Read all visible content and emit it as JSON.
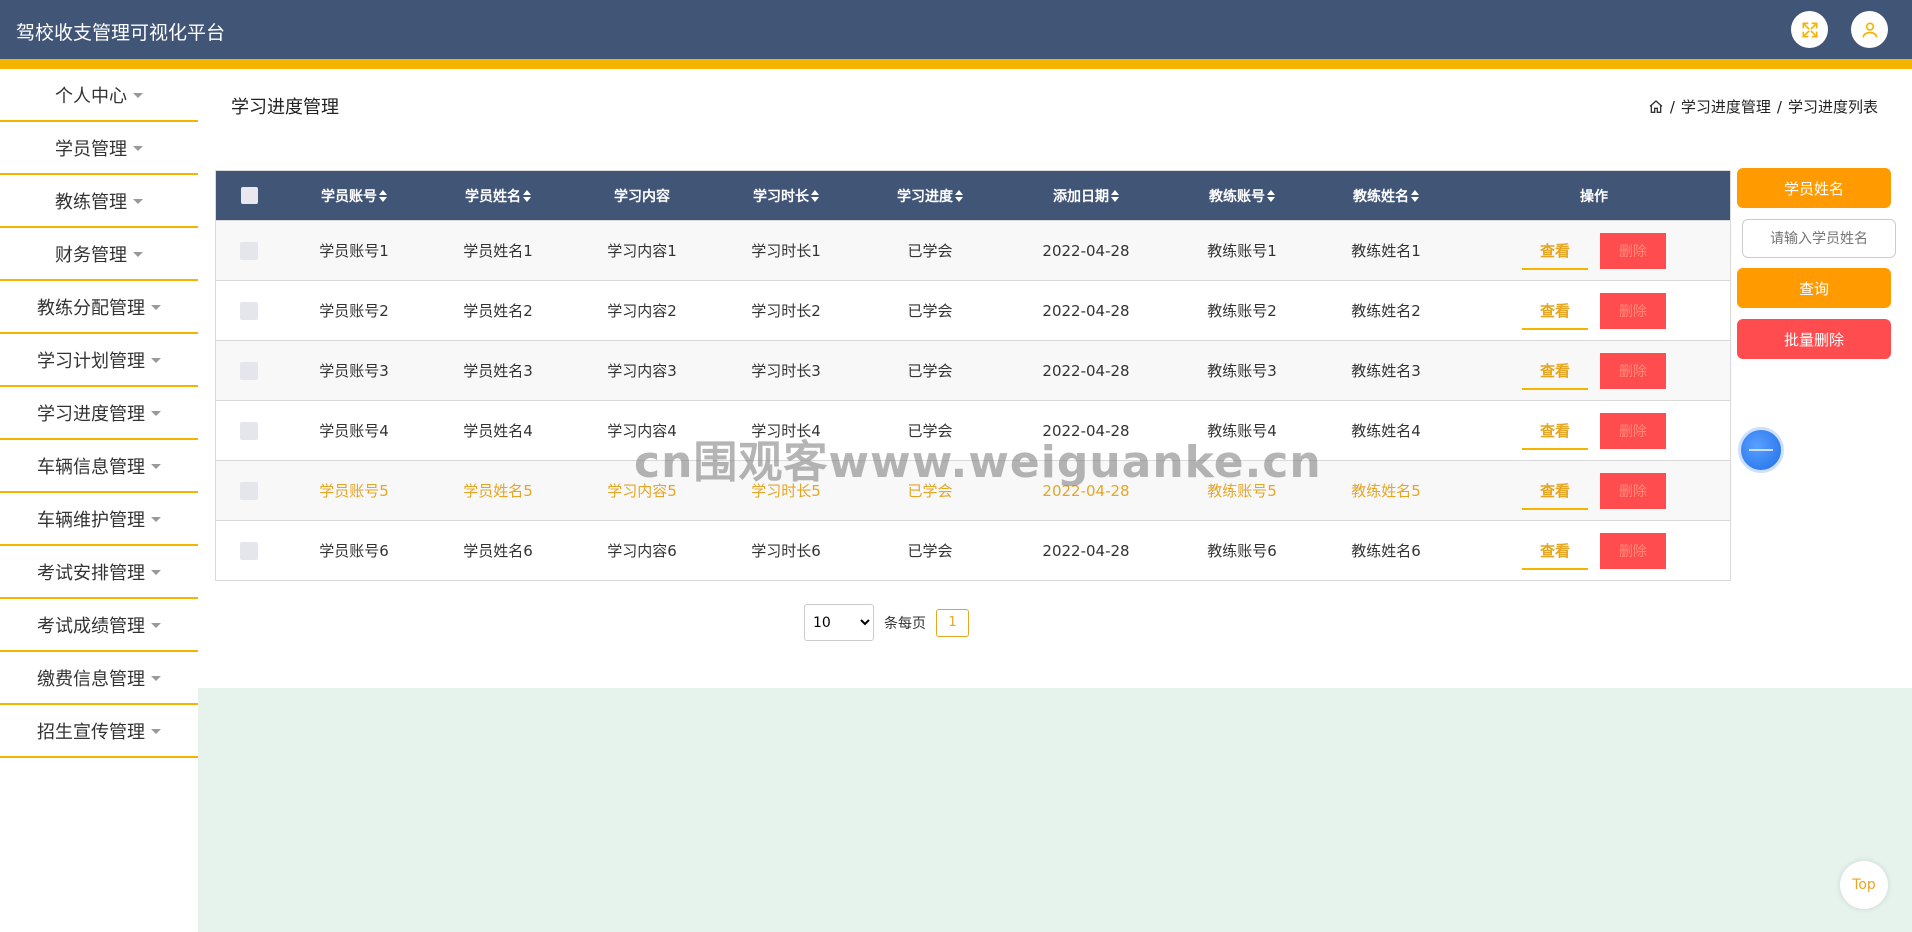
{
  "header": {
    "title": "驾校收支管理可视化平台",
    "fullscreen_icon": "expand-icon",
    "user_icon": "user-icon"
  },
  "sidebar": {
    "items": [
      {
        "label": "个人中心"
      },
      {
        "label": "学员管理"
      },
      {
        "label": "教练管理"
      },
      {
        "label": "财务管理"
      },
      {
        "label": "教练分配管理"
      },
      {
        "label": "学习计划管理"
      },
      {
        "label": "学习进度管理"
      },
      {
        "label": "车辆信息管理"
      },
      {
        "label": "车辆维护管理"
      },
      {
        "label": "考试安排管理"
      },
      {
        "label": "考试成绩管理"
      },
      {
        "label": "缴费信息管理"
      },
      {
        "label": "招生宣传管理"
      }
    ]
  },
  "page": {
    "title": "学习进度管理"
  },
  "breadcrumb": {
    "home_icon": "home-icon",
    "sep": "/",
    "level1": "学习进度管理",
    "level2": "学习进度列表"
  },
  "table": {
    "headers": [
      "学员账号",
      "学员姓名",
      "学习内容",
      "学习时长",
      "学习进度",
      "添加日期",
      "教练账号",
      "教练姓名",
      "操作"
    ],
    "rows": [
      {
        "cells": [
          "学员账号1",
          "学员姓名1",
          "学习内容1",
          "学习时长1",
          "已学会",
          "2022-04-28",
          "教练账号1",
          "教练姓名1"
        ]
      },
      {
        "cells": [
          "学员账号2",
          "学员姓名2",
          "学习内容2",
          "学习时长2",
          "已学会",
          "2022-04-28",
          "教练账号2",
          "教练姓名2"
        ]
      },
      {
        "cells": [
          "学员账号3",
          "学员姓名3",
          "学习内容3",
          "学习时长3",
          "已学会",
          "2022-04-28",
          "教练账号3",
          "教练姓名3"
        ]
      },
      {
        "cells": [
          "学员账号4",
          "学员姓名4",
          "学习内容4",
          "学习时长4",
          "已学会",
          "2022-04-28",
          "教练账号4",
          "教练姓名4"
        ]
      },
      {
        "cells": [
          "学员账号5",
          "学员姓名5",
          "学习内容5",
          "学习时长5",
          "已学会",
          "2022-04-28",
          "教练账号5",
          "教练姓名5"
        ]
      },
      {
        "cells": [
          "学员账号6",
          "学员姓名6",
          "学习内容6",
          "学习时长6",
          "已学会",
          "2022-04-28",
          "教练账号6",
          "教练姓名6"
        ]
      }
    ],
    "view_label": "查看",
    "delete_label": "删除"
  },
  "pagination": {
    "page_size": "10",
    "per_page_label": "条每页",
    "current_page": "1"
  },
  "search": {
    "field_label": "学员姓名",
    "placeholder": "请输入学员姓名",
    "search_button": "查询",
    "batch_delete_button": "批量删除"
  },
  "watermark": "cn围观客www.weiguanke.cn",
  "back_to_top": "Top",
  "colors": {
    "header": "#415577",
    "accent": "#f5b400",
    "orange_button": "#ff9b00",
    "danger": "#ff4d4f",
    "highlight_text": "#e5a624"
  }
}
